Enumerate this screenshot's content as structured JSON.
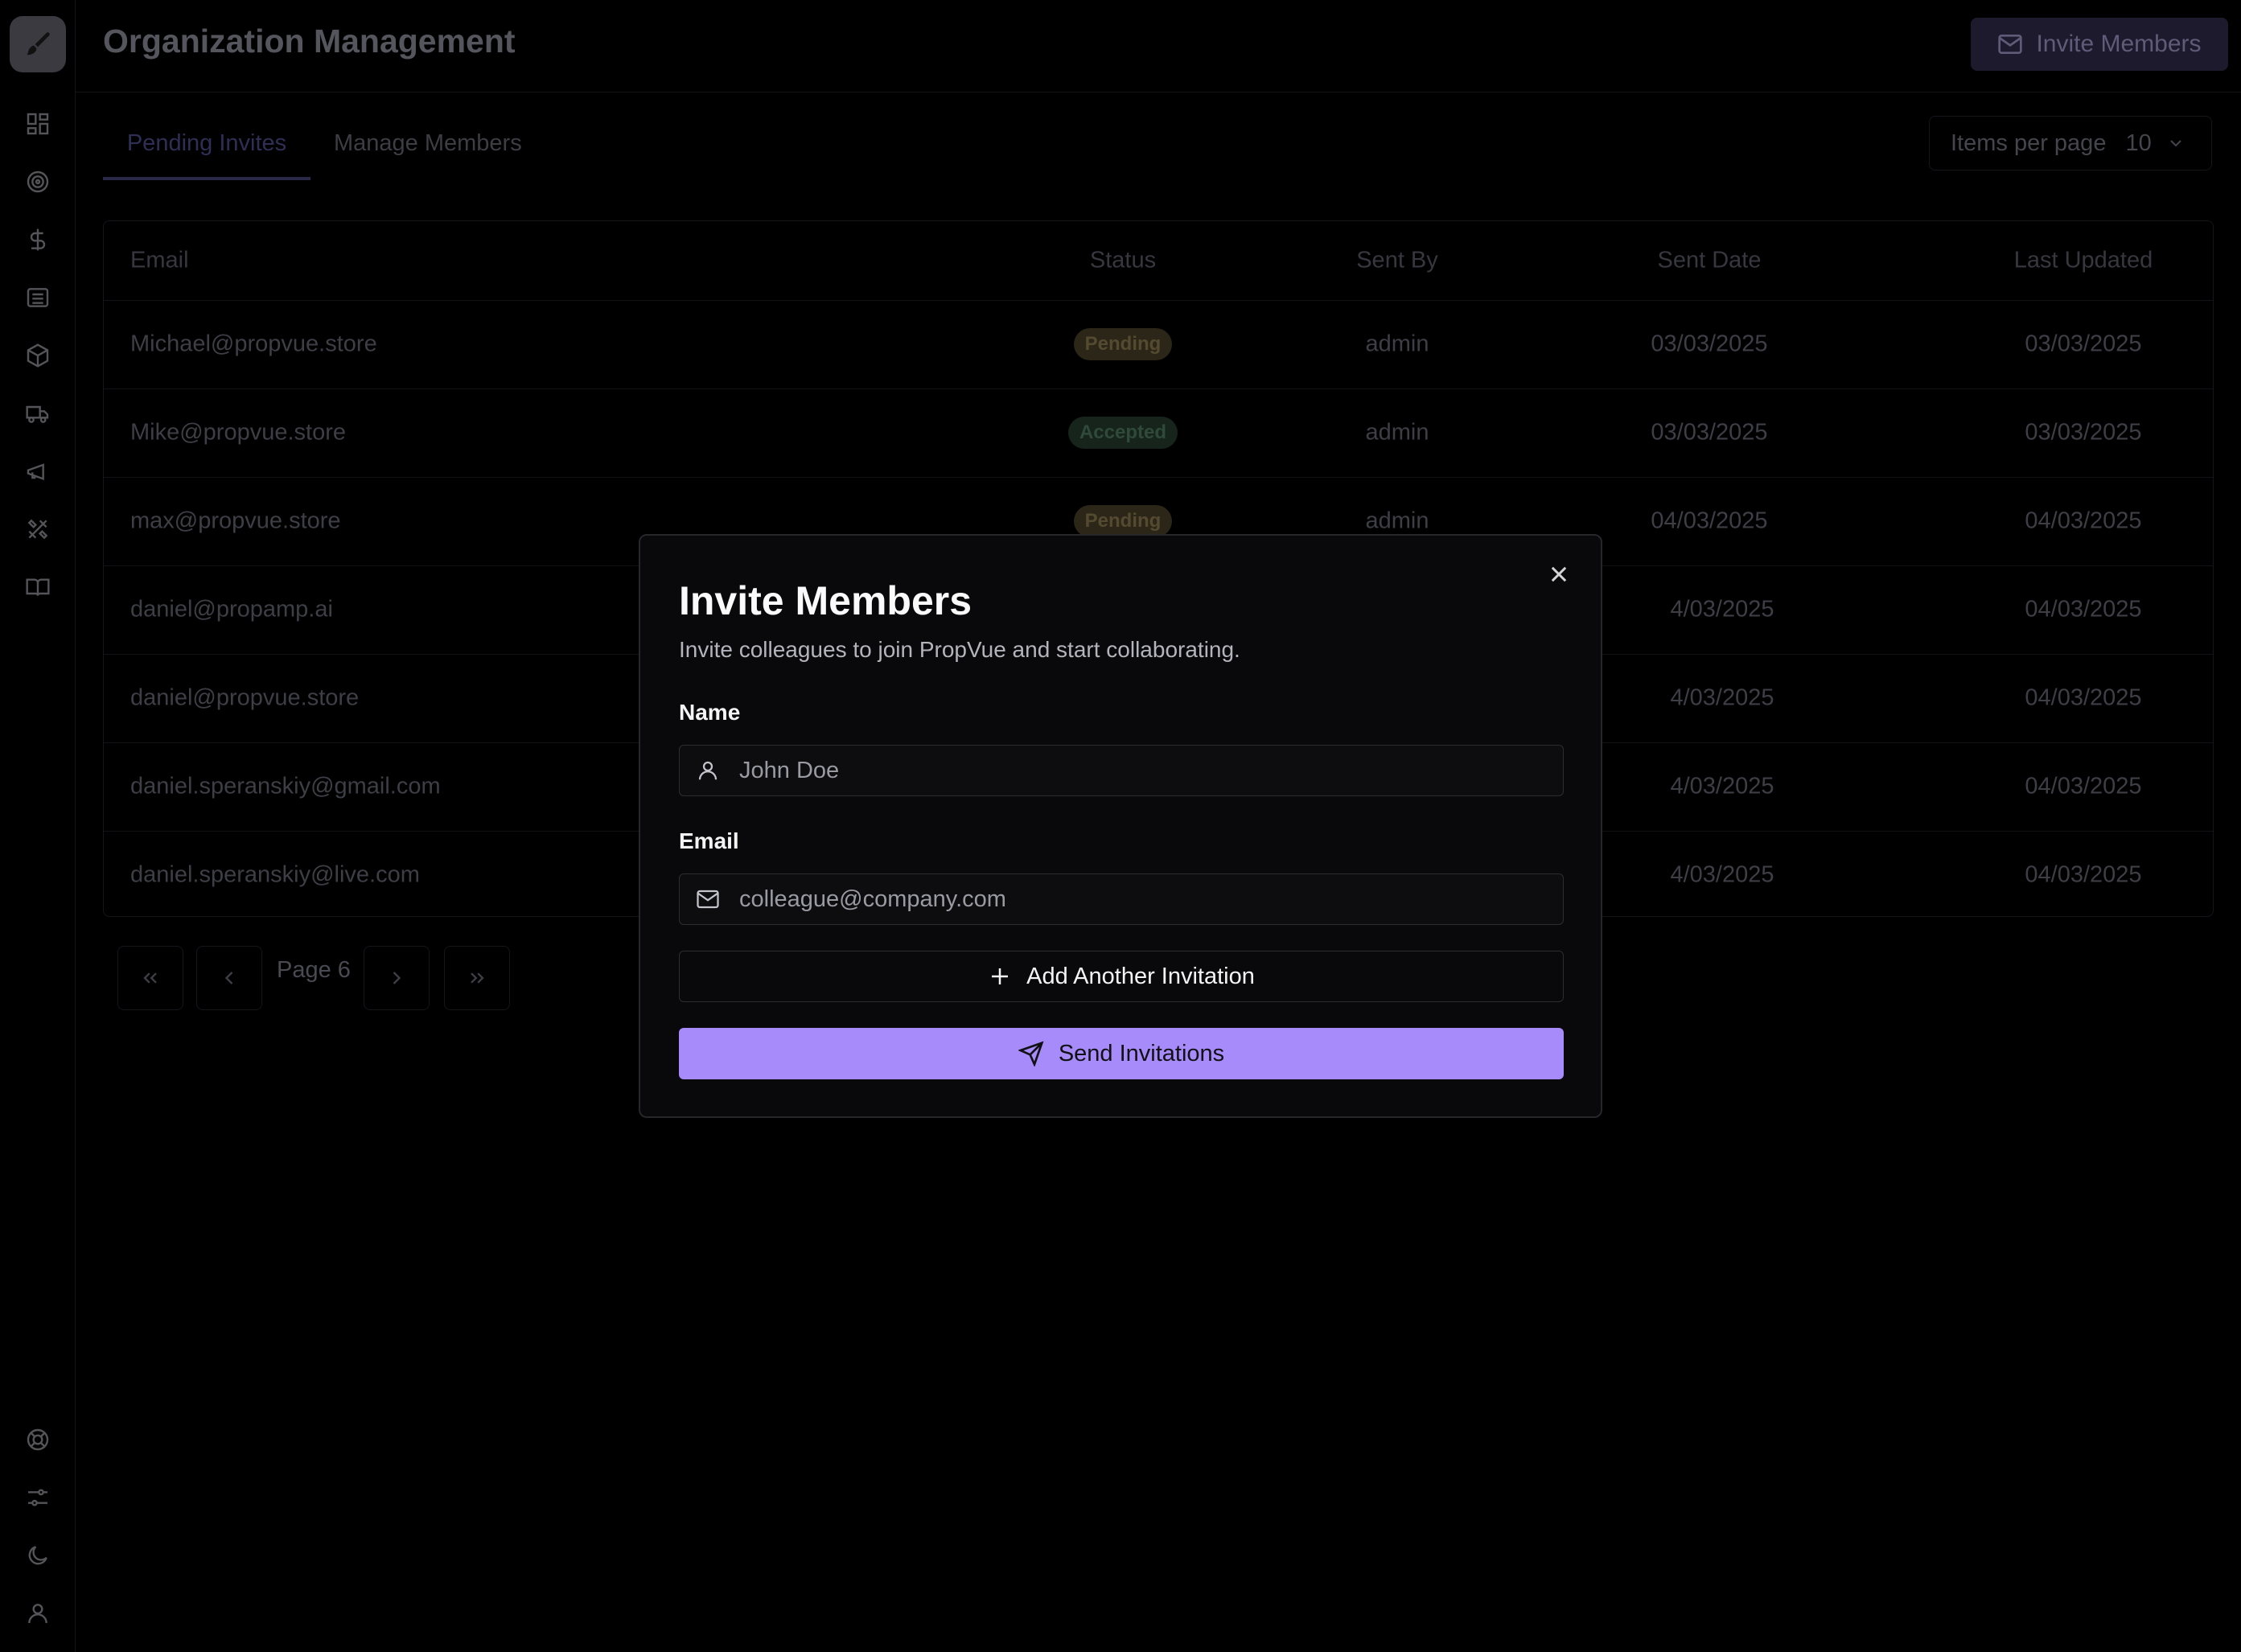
{
  "header": {
    "title": "Organization Management",
    "invite_button": "Invite Members"
  },
  "sidebar": {
    "top_icons": [
      "dashboard-icon",
      "target-icon",
      "dollar-icon",
      "list-icon",
      "box-icon",
      "truck-icon",
      "megaphone-icon",
      "tools-icon",
      "book-icon"
    ],
    "bottom_icons": [
      "lifebuoy-icon",
      "sliders-icon",
      "moon-icon",
      "user-icon"
    ]
  },
  "tabs": [
    {
      "label": "Pending Invites",
      "active": true
    },
    {
      "label": "Manage Members",
      "active": false
    }
  ],
  "items_per_page": {
    "label": "Items per page",
    "value": "10"
  },
  "table": {
    "columns": [
      "Email",
      "Status",
      "Sent By",
      "Sent Date",
      "Last Updated"
    ],
    "rows": [
      {
        "email": "Michael@propvue.store",
        "status": "Pending",
        "sent_by": "admin",
        "sent_date": "03/03/2025",
        "last_updated": "03/03/2025"
      },
      {
        "email": "Mike@propvue.store",
        "status": "Accepted",
        "sent_by": "admin",
        "sent_date": "03/03/2025",
        "last_updated": "03/03/2025"
      },
      {
        "email": "max@propvue.store",
        "status": "Pending",
        "sent_by": "admin",
        "sent_date": "04/03/2025",
        "last_updated": "04/03/2025"
      },
      {
        "email": "daniel@propamp.ai",
        "status": "",
        "sent_by": "",
        "sent_date": "4/03/2025",
        "last_updated": "04/03/2025"
      },
      {
        "email": "daniel@propvue.store",
        "status": "",
        "sent_by": "",
        "sent_date": "4/03/2025",
        "last_updated": "04/03/2025"
      },
      {
        "email": "daniel.speranskiy@gmail.com",
        "status": "",
        "sent_by": "",
        "sent_date": "4/03/2025",
        "last_updated": "04/03/2025"
      },
      {
        "email": "daniel.speranskiy@live.com",
        "status": "",
        "sent_by": "",
        "sent_date": "4/03/2025",
        "last_updated": "04/03/2025"
      }
    ]
  },
  "pagination": {
    "label": "Page 6"
  },
  "modal": {
    "title": "Invite Members",
    "subtitle": "Invite colleagues to join PropVue and start collaborating.",
    "name_label": "Name",
    "name_placeholder": "John Doe",
    "email_label": "Email",
    "email_placeholder": "colleague@company.com",
    "add_button": "Add Another Invitation",
    "send_button": "Send Invitations"
  },
  "colors": {
    "accent": "#a78bfa",
    "background": "#000000",
    "modal_background": "#09090b"
  }
}
